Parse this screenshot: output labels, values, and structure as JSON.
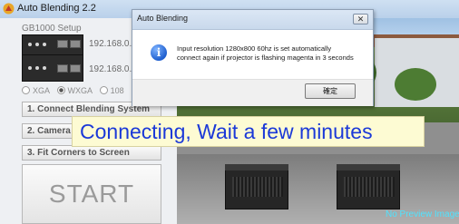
{
  "window": {
    "title": "Auto Blending 2.2"
  },
  "left_panel": {
    "setup_label": "GB1000 Setup",
    "devices": [
      {
        "ip": "192.168.0."
      },
      {
        "ip": "192.168.0."
      }
    ],
    "resolution_options": [
      {
        "label": "XGA",
        "selected": false
      },
      {
        "label": "WXGA",
        "selected": true
      },
      {
        "label": "108",
        "selected": false
      }
    ],
    "steps": [
      "1. Connect Blending System",
      "2. Camera Calibration",
      "3. Fit Corners to Screen"
    ],
    "start_label": "START"
  },
  "preview": {
    "no_preview_text": "No Preview Image"
  },
  "banner": {
    "text": "Connecting, Wait a few minutes"
  },
  "dialog": {
    "title": "Auto Blending",
    "close_glyph": "✕",
    "message_line1": "Input resolution 1280x800 60hz is set automatically",
    "message_line2": "connect again if projector is flashing magenta in 3 seconds",
    "ok_label": "確定",
    "icon": "info-icon"
  },
  "colors": {
    "banner_text": "#1b39d8",
    "banner_bg": "#fdfbd3",
    "no_preview_text": "#4fe3ff"
  }
}
